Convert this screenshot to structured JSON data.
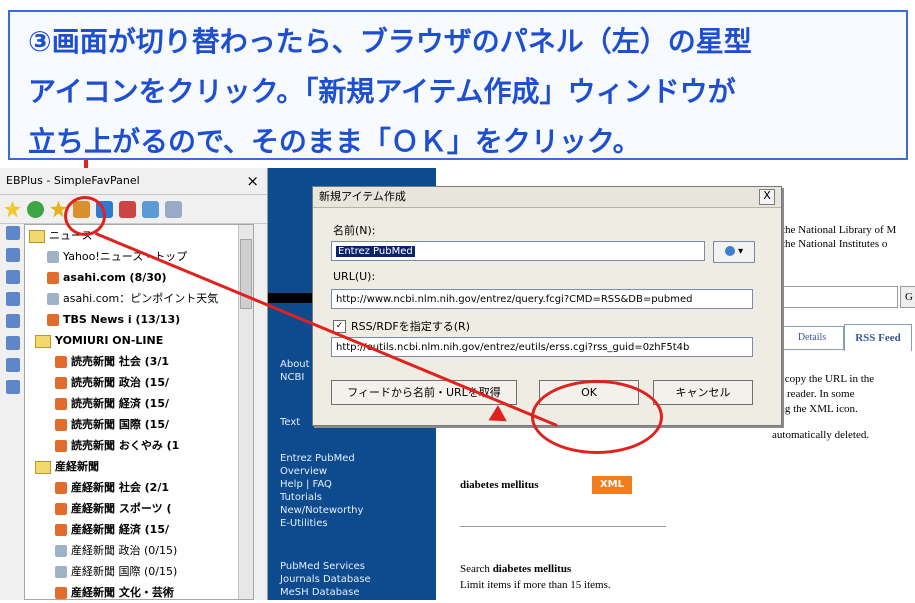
{
  "callout": {
    "line1": "③画面が切り替わったら、ブラウザのパネル（左）の星型",
    "line2": "アイコンをクリック。「新規アイテム作成」ウィンドウが",
    "line3": "立ち上がるので、そのまま「ＯＫ」をクリック。"
  },
  "panel": {
    "title": "EBPlus - SimpleFavPanel",
    "close_label": "×",
    "items": [
      {
        "label": "ニュース",
        "kind": "folder",
        "bold": false
      },
      {
        "label": "Yahoo!ニュース - トップ",
        "kind": "feed-gray",
        "bold": false
      },
      {
        "label": "asahi.com (8/30)",
        "kind": "feed",
        "bold": true
      },
      {
        "label": "asahi.com：ピンポイント天気",
        "kind": "feed-gray",
        "bold": false
      },
      {
        "label": "TBS News i (13/13)",
        "kind": "feed",
        "bold": true
      },
      {
        "label": "YOMIURI ON-LINE",
        "kind": "folder",
        "bold": true
      },
      {
        "label": "読売新聞 社会 (3/1",
        "kind": "feed",
        "bold": true
      },
      {
        "label": "読売新聞 政治 (15/",
        "kind": "feed",
        "bold": true
      },
      {
        "label": "読売新聞 経済 (15/",
        "kind": "feed",
        "bold": true
      },
      {
        "label": "読売新聞 国際 (15/",
        "kind": "feed",
        "bold": true
      },
      {
        "label": "読売新聞 おくやみ (1",
        "kind": "feed",
        "bold": true
      },
      {
        "label": "産経新聞",
        "kind": "folder",
        "bold": true
      },
      {
        "label": "産経新聞 社会 (2/1",
        "kind": "feed",
        "bold": true
      },
      {
        "label": "産経新聞 スポーツ (",
        "kind": "feed",
        "bold": true
      },
      {
        "label": "産経新聞 経済 (15/",
        "kind": "feed",
        "bold": true
      },
      {
        "label": "産経新聞 政治 (0/15)",
        "kind": "feed-gray",
        "bold": false
      },
      {
        "label": "産経新聞 国際 (0/15)",
        "kind": "feed-gray",
        "bold": false
      },
      {
        "label": "産経新聞 文化・芸術",
        "kind": "feed",
        "bold": true
      }
    ]
  },
  "bluepage": {
    "about": "About",
    "ncbi": "NCBI",
    "text": "Text",
    "links": [
      "Entrez PubMed",
      "Overview",
      "Help | FAQ",
      "Tutorials",
      "New/Noteworthy",
      "E-Utilities"
    ],
    "services": [
      "PubMed Services",
      "Journals Database",
      "MeSH Database"
    ]
  },
  "webpage": {
    "header_line1": "the National Library of M",
    "header_line2": "the National Institutes o",
    "tab_details": "Details",
    "tab_rss": "RSS Feed",
    "search_button": "G",
    "text1": "w, copy the URL in the",
    "text2": "SS reader. In some",
    "text3": "sing the XML icon.",
    "text4": "automatically deleted.",
    "diabetes_label": "diabetes mellitus",
    "xml_badge": "XML",
    "search_prefix": "Search",
    "search_term": "diabetes mellitus",
    "limit_text": "Limit items if more than 15 items."
  },
  "dialog": {
    "title": "新規アイテム作成",
    "close_label": "X",
    "name_label": "名前(N):",
    "name_value": "Entrez PubMed",
    "url_label": "URL(U):",
    "url_value": "http://www.ncbi.nlm.nih.gov/entrez/query.fcgi?CMD=RSS&DB=pubmed",
    "rss_checkbox_label": "RSS/RDFを指定する(R)",
    "rss_checkbox_checked": "✓",
    "rss_value": "http://eutils.ncbi.nlm.nih.gov/entrez/eutils/erss.cgi?rss_guid=0zhF5t4b",
    "fetch_button": "フィードから名前・URLを取得",
    "ok_button": "OK",
    "cancel_button": "キャンセル"
  },
  "colors": {
    "accent": "#1f4fd1",
    "annotation": "#e0211e",
    "bluepage": "#0d4a8e",
    "selection": "#0a246a"
  }
}
